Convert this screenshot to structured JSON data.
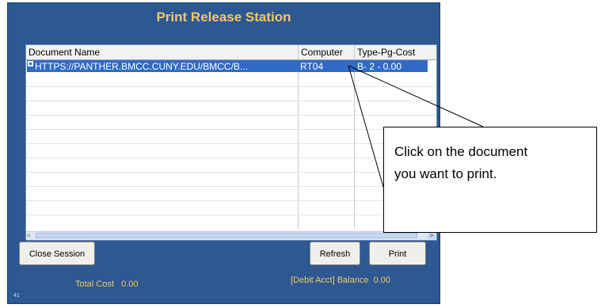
{
  "window": {
    "title": "Print Release Station",
    "corner_label": "41"
  },
  "job_list": {
    "columns": [
      "Document Name",
      "Computer",
      "Type-Pg-Cost"
    ],
    "rows": [
      {
        "document_name": "HTTPS://PANTHER.BMCC.CUNY.EDU/BMCC/B...",
        "computer": "RT04",
        "type_pg_cost": "B- 2 - 0.00",
        "selected": true,
        "icon": "document-icon"
      }
    ]
  },
  "buttons": {
    "close_session": "Close Session",
    "refresh": "Refresh",
    "print": "Print"
  },
  "totals": {
    "total_cost_label": "Total Cost",
    "total_cost_value": "0.00",
    "balance_label": "[Debit Acct] Balance",
    "balance_value": "0.00"
  },
  "callout": {
    "line1": "Click on the document",
    "line2": "you want to print."
  },
  "colors": {
    "panel": "#2d5891",
    "title": "#f2c86a",
    "selection": "#316ac5"
  }
}
